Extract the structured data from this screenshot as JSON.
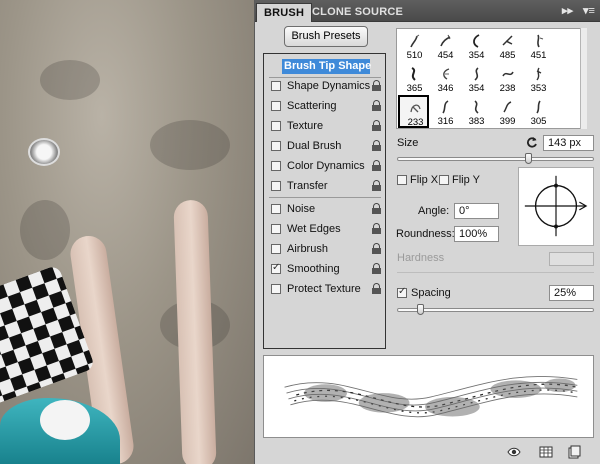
{
  "panel": {
    "tabs": [
      {
        "label": "BRUSH",
        "active": true
      },
      {
        "label": "CLONE SOURCE",
        "active": false
      }
    ],
    "tab_controls": [
      "▸▸",
      "▾≡"
    ],
    "presets_button": "Brush Presets",
    "options": [
      {
        "label": "Brush Tip Shape",
        "selected": true,
        "checkbox": false,
        "lock": false
      },
      {
        "label": "Shape Dynamics",
        "checked": false,
        "lock": true
      },
      {
        "label": "Scattering",
        "checked": false,
        "lock": true
      },
      {
        "label": "Texture",
        "checked": false,
        "lock": true
      },
      {
        "label": "Dual Brush",
        "checked": false,
        "lock": true
      },
      {
        "label": "Color Dynamics",
        "checked": false,
        "lock": true
      },
      {
        "label": "Transfer",
        "checked": false,
        "lock": true
      },
      {
        "label": "Noise",
        "checked": false,
        "lock": true
      },
      {
        "label": "Wet Edges",
        "checked": false,
        "lock": true
      },
      {
        "label": "Airbrush",
        "checked": false,
        "lock": true
      },
      {
        "label": "Smoothing",
        "checked": true,
        "lock": true
      },
      {
        "label": "Protect Texture",
        "checked": false,
        "lock": true
      }
    ],
    "brushes": [
      [
        "510",
        "454",
        "354",
        "485",
        "451"
      ],
      [
        "365",
        "346",
        "354",
        "238",
        "353"
      ],
      [
        "233",
        "316",
        "383",
        "399",
        "305"
      ]
    ],
    "selected_brush": "233",
    "size": {
      "label": "Size",
      "value": "143 px",
      "fraction": 0.67
    },
    "flip_x": {
      "label": "Flip X",
      "checked": false
    },
    "flip_y": {
      "label": "Flip Y",
      "checked": false
    },
    "angle": {
      "label": "Angle:",
      "value": "0°"
    },
    "roundness": {
      "label": "Roundness:",
      "value": "100%"
    },
    "hardness": {
      "label": "Hardness"
    },
    "spacing": {
      "label": "Spacing",
      "checked": true,
      "value": "25%",
      "fraction": 0.12
    },
    "icons": [
      "rotate-reset-icon",
      "eye-icon",
      "new-preset-icon",
      "create-brush-icon"
    ]
  }
}
